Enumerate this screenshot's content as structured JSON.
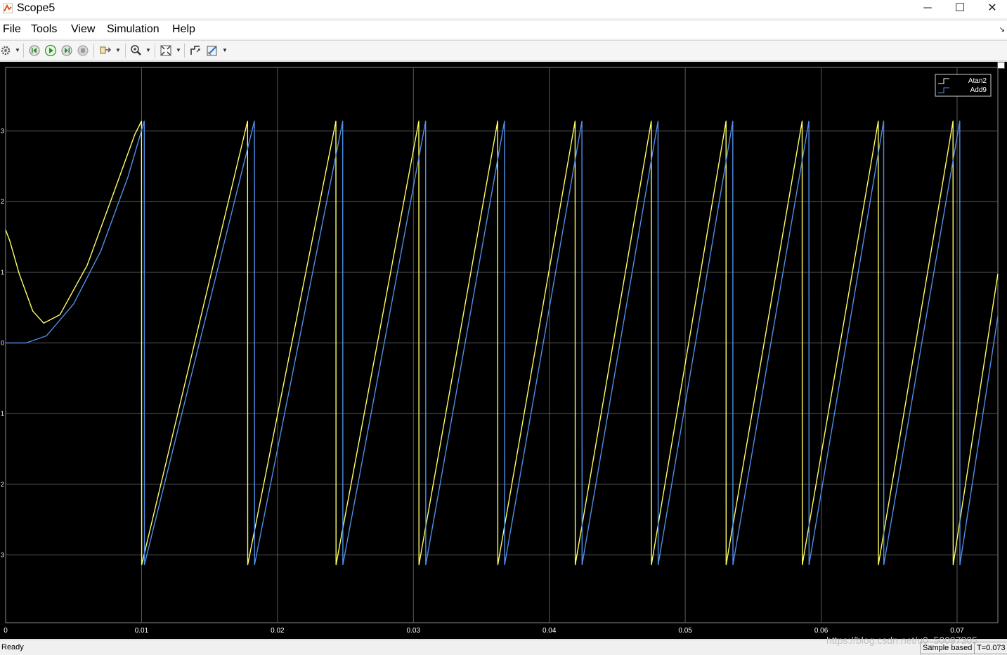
{
  "window": {
    "title": "Scope5",
    "minimize_glyph": "─",
    "maximize_glyph": "☐",
    "close_glyph": "✕"
  },
  "menu": {
    "items": [
      "File",
      "Tools",
      "View",
      "Simulation",
      "Help"
    ],
    "corner_glyph": "↘"
  },
  "toolbar": {
    "icons": [
      "settings-icon",
      "step-back-icon",
      "run-icon",
      "step-forward-icon",
      "stop-icon",
      "highlight-block-icon",
      "zoom-icon",
      "autoscale-icon",
      "signal-select-icon",
      "style-icon"
    ]
  },
  "status": {
    "left": "Ready",
    "mode": "Sample based",
    "time": "T=0.073"
  },
  "watermark": "https://blog.csdn.net/u0_50097305",
  "colors": {
    "atan2": "#ffff66",
    "add9": "#4f8fe8",
    "grid": "#5a5a5a",
    "tick_text": "#ffffff"
  },
  "chart_data": {
    "type": "line",
    "title": "",
    "xlabel": "",
    "ylabel": "",
    "xlim": [
      0,
      0.073
    ],
    "ylim": [
      -3.96,
      3.9
    ],
    "x_ticks": [
      0,
      0.01,
      0.02,
      0.03,
      0.04,
      0.05,
      0.06,
      0.07
    ],
    "x_tick_labels": [
      "0",
      "0.01",
      "0.02",
      "0.03",
      "0.04",
      "0.05",
      "0.06",
      "0.07"
    ],
    "y_ticks": [
      -3,
      -2,
      -1,
      0,
      1,
      2,
      3
    ],
    "y_tick_labels": [
      "3",
      "2",
      "1",
      "0",
      "1",
      "2",
      "3"
    ],
    "grid": true,
    "legend_position": "top-right",
    "series": [
      {
        "name": "Atan2",
        "x": [
          0,
          0.0003,
          0.001,
          0.002,
          0.0028,
          0.004,
          0.006,
          0.008,
          0.0095,
          0.01,
          0.01001,
          0.0178,
          0.01781,
          0.0243,
          0.02431,
          0.0304,
          0.03041,
          0.0362,
          0.03621,
          0.0419,
          0.04191,
          0.0475,
          0.04751,
          0.053,
          0.05301,
          0.0586,
          0.05861,
          0.0642,
          0.06421,
          0.0697,
          0.06971,
          0.073
        ],
        "values": [
          1.6,
          1.45,
          0.98,
          0.45,
          0.28,
          0.4,
          1.1,
          2.15,
          2.95,
          3.14,
          -3.14,
          3.14,
          -3.14,
          3.14,
          -3.14,
          3.14,
          -3.14,
          3.14,
          -3.14,
          3.14,
          -3.14,
          3.14,
          -3.14,
          3.14,
          -3.14,
          3.14,
          -3.14,
          3.14,
          -3.14,
          3.14,
          -3.14,
          0.98
        ]
      },
      {
        "name": "Add9",
        "x": [
          0,
          0.0015,
          0.003,
          0.005,
          0.007,
          0.009,
          0.0102,
          0.01021,
          0.0183,
          0.01831,
          0.0248,
          0.02481,
          0.0309,
          0.03091,
          0.0367,
          0.03671,
          0.0424,
          0.04241,
          0.048,
          0.04801,
          0.0535,
          0.05351,
          0.0591,
          0.05911,
          0.0646,
          0.06461,
          0.0702,
          0.07021,
          0.073
        ],
        "values": [
          0,
          0,
          0.1,
          0.55,
          1.3,
          2.35,
          3.14,
          -3.14,
          3.14,
          -3.14,
          3.14,
          -3.14,
          3.14,
          -3.14,
          3.14,
          -3.14,
          3.14,
          -3.14,
          3.14,
          -3.14,
          3.14,
          -3.14,
          3.14,
          -3.14,
          3.14,
          -3.14,
          3.14,
          -3.14,
          0.38
        ]
      }
    ]
  }
}
